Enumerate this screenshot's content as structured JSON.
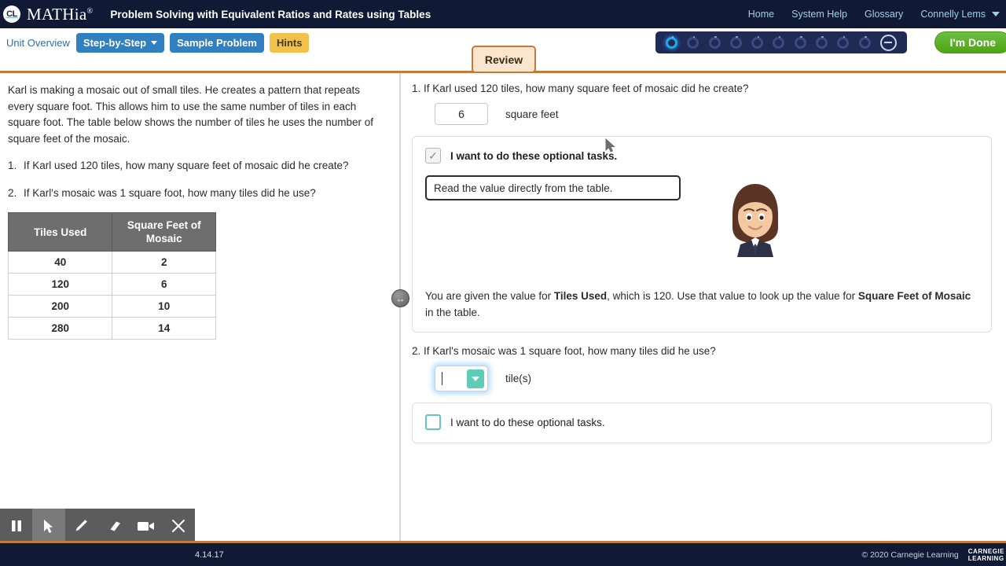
{
  "topbar": {
    "logo_text": "CL",
    "brand": "MATHia",
    "brand_mark": "®",
    "lesson_title": "Problem Solving with Equivalent Ratios and Rates using Tables",
    "links": [
      {
        "label": "Home",
        "name": "home"
      },
      {
        "label": "System Help",
        "name": "system-help"
      },
      {
        "label": "Glossary",
        "name": "glossary"
      },
      {
        "label": "Connelly Lems",
        "name": "user-menu"
      }
    ]
  },
  "toolbar": {
    "unit_overview": "Unit Overview",
    "step_by_step": "Step-by-Step",
    "sample_problem": "Sample Problem",
    "hints": "Hints",
    "done_button": "I'm Done",
    "review_tab": "Review",
    "progress": {
      "total": 10,
      "active_index": 0
    }
  },
  "left_panel": {
    "scenario": "Karl is making a mosaic out of small tiles. He creates a pattern that repeats every square foot. This allows him to use the same number of tiles in each square foot. The table below shows the number of tiles he uses the number of square feet of the mosaic.",
    "questions": [
      {
        "num": "1.",
        "text": "If Karl used 120 tiles, how many square feet of mosaic did he create?"
      },
      {
        "num": "2.",
        "text": "If Karl's mosaic was 1 square foot, how many tiles did he use?"
      }
    ],
    "table": {
      "headers": [
        "Tiles Used",
        "Square Feet of Mosaic"
      ],
      "rows": [
        [
          "40",
          "2"
        ],
        [
          "120",
          "6"
        ],
        [
          "200",
          "10"
        ],
        [
          "280",
          "14"
        ]
      ]
    }
  },
  "right_panel": {
    "q1": {
      "prompt": "1. If Karl used 120 tiles, how many square feet of mosaic did he create?",
      "answer_value": "6",
      "unit_label": "square feet",
      "optional_checkbox_label": "I want to do these optional tasks.",
      "optional_checked": true,
      "hint_text": "Read the value directly from the table.",
      "explanation_prefix": "You are given the value for ",
      "explanation_bold1": "Tiles Used",
      "explanation_mid": ", which is 120. Use that value to look up the value for ",
      "explanation_bold2": "Square Feet of Mosaic",
      "explanation_suffix": " in the table."
    },
    "q2": {
      "prompt": "2. If Karl's mosaic was 1 square foot, how many tiles did he use?",
      "answer_value": "",
      "unit_label": "tile(s)",
      "optional_checkbox_label": "I want to do these optional tasks.",
      "optional_checked": false
    }
  },
  "recorder": {
    "buttons": [
      {
        "name": "pause-icon",
        "glyph": "pause"
      },
      {
        "name": "cursor-icon",
        "glyph": "cursor"
      },
      {
        "name": "pencil-icon",
        "glyph": "pencil"
      },
      {
        "name": "eraser-icon",
        "glyph": "eraser"
      },
      {
        "name": "camera-icon",
        "glyph": "camera"
      },
      {
        "name": "close-icon",
        "glyph": "close"
      }
    ]
  },
  "footer": {
    "version": "4.14.17",
    "copyright": "© 2020 Carnegie Learning",
    "logo_line1": "CARNEGIE",
    "logo_line2": "LEARNING"
  },
  "colors": {
    "navy": "#111a35",
    "orange_rule": "#c07a3e",
    "blue_pill": "#2f7fc1",
    "gold_pill": "#f0c24b",
    "green_done": "#4fa314",
    "teal_accent": "#5fcdb5",
    "table_header": "#6e6e6e"
  }
}
